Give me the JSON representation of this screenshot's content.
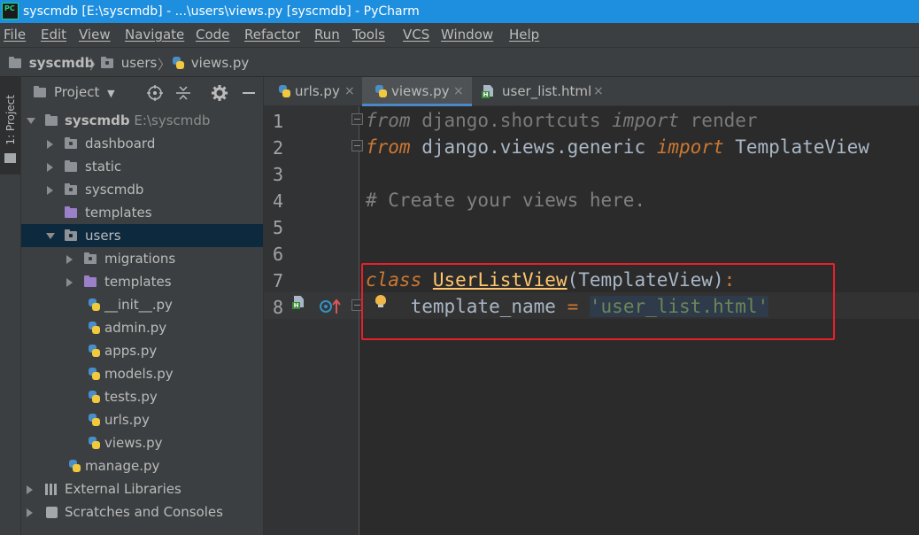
{
  "window": {
    "title": "syscmdb [E:\\syscmdb] - ...\\users\\views.py [syscmdb] - PyCharm",
    "logo_text": "PC"
  },
  "menu": [
    "File",
    "Edit",
    "View",
    "Navigate",
    "Code",
    "Refactor",
    "Run",
    "Tools",
    "VCS",
    "Window",
    "Help"
  ],
  "breadcrumb": [
    "syscmdb",
    "users",
    "views.py"
  ],
  "toolstrip": {
    "project_tab": "1: Project"
  },
  "project_panel": {
    "title": "Project",
    "icons": [
      "target-icon",
      "collapse-icon",
      "gear-icon",
      "minimize-icon"
    ],
    "root": {
      "name": "syscmdb",
      "path": "E:\\syscmdb"
    },
    "items": [
      {
        "label": "dashboard"
      },
      {
        "label": "static"
      },
      {
        "label": "syscmdb"
      },
      {
        "label": "templates"
      },
      {
        "label": "users"
      },
      {
        "label": "migrations"
      },
      {
        "label": "templates"
      },
      {
        "label": "__init__.py"
      },
      {
        "label": "admin.py"
      },
      {
        "label": "apps.py"
      },
      {
        "label": "models.py"
      },
      {
        "label": "tests.py"
      },
      {
        "label": "urls.py"
      },
      {
        "label": "views.py"
      },
      {
        "label": "manage.py"
      },
      {
        "label": "External Libraries"
      },
      {
        "label": "Scratches and Consoles"
      }
    ],
    "selected": "users"
  },
  "tabs": [
    {
      "label": "urls.py",
      "close": "×"
    },
    {
      "label": "views.py",
      "close": "×",
      "active": true
    },
    {
      "label": "user_list.html",
      "close": "×"
    }
  ],
  "editor": {
    "line_numbers": [
      "1",
      "2",
      "3",
      "4",
      "5",
      "6",
      "7",
      "8"
    ],
    "code": {
      "l1": {
        "kw1": "from",
        "mod": " django.shortcuts ",
        "kw2": "import",
        "name": " render"
      },
      "l2": {
        "kw1": "from",
        "mod": " django.views.generic ",
        "kw2": "import",
        "name": " TemplateView"
      },
      "l4": "# Create your views here.",
      "l7": {
        "kw": "class",
        "sp": " ",
        "cls": "UserListView",
        "base": "(TemplateView)",
        "colon": ":"
      },
      "l8": {
        "indent": "    ",
        "name": "template_name",
        "eq": " = ",
        "str": "'user_list.html'"
      }
    },
    "current_line": 8
  },
  "colors": {
    "titlebar": "#1e8fdf",
    "keyword": "#cc7832",
    "string": "#6a8759",
    "class_def": "#ffc66d",
    "highlight_box": "#e8202a"
  }
}
